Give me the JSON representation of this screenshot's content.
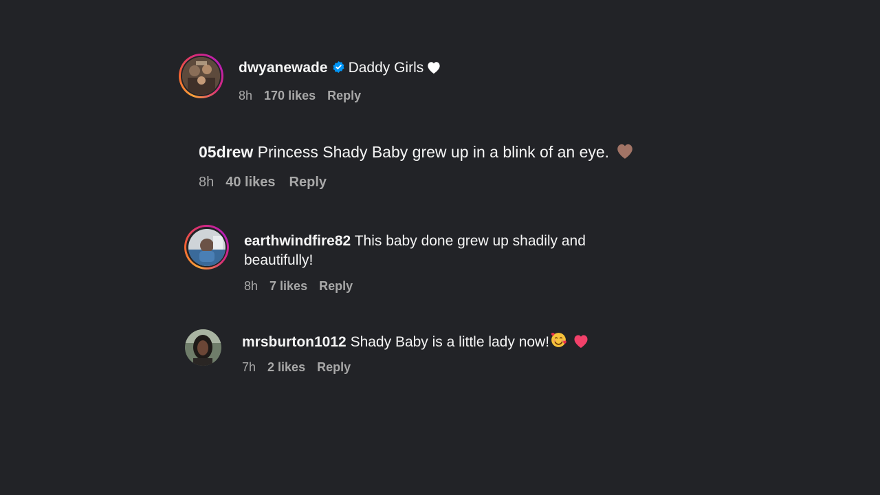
{
  "comments": [
    {
      "username": "dwyanewade",
      "verified": true,
      "text": "Daddy Girls",
      "emoji": "white-heart",
      "time": "8h",
      "likes": "170 likes",
      "reply": "Reply",
      "avatar": "story-ring"
    },
    {
      "username": "05drew",
      "text": "Princess Shady Baby grew up in a blink of an eye.",
      "emoji": "brown-heart",
      "time": "8h",
      "likes": "40 likes",
      "reply": "Reply"
    },
    {
      "username": "earthwindfire82",
      "text_line1": "This baby done grew up shadily and",
      "text_line2": "beautifully!",
      "time": "8h",
      "likes": "7 likes",
      "reply": "Reply",
      "avatar": "story-ring"
    },
    {
      "username": "mrsburton1012",
      "text": "Shady Baby is a little lady now!",
      "emoji": [
        "smiling-face-with-hearts",
        "pink-heart"
      ],
      "time": "7h",
      "likes": "2 likes",
      "reply": "Reply"
    }
  ],
  "colors": {
    "background": "#222327",
    "text": "#f5f5f5",
    "meta": "#a8a8a8",
    "verified": "#0095f6"
  }
}
